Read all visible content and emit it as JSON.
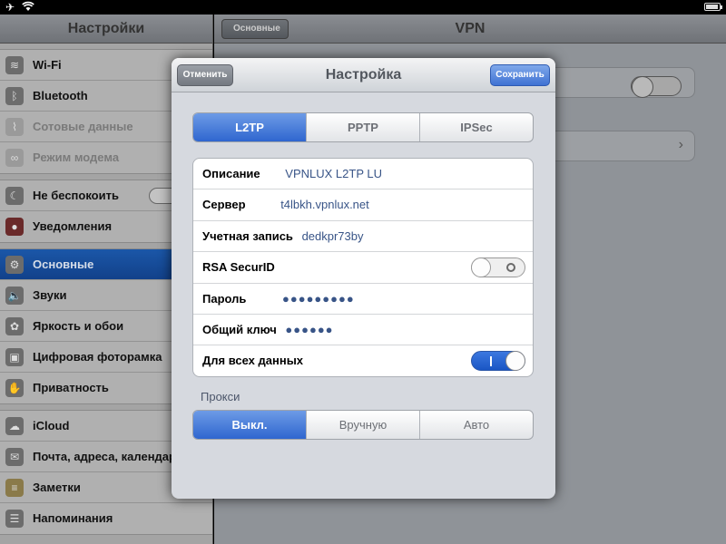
{
  "sidebar": {
    "title": "Настройки",
    "groups": [
      [
        {
          "label": "Wi-Fi",
          "icon": "wifi-icon",
          "state": "normal"
        },
        {
          "label": "Bluetooth",
          "icon": "bluetooth-icon",
          "state": "normal"
        },
        {
          "label": "Сотовые данные",
          "icon": "cellular-icon",
          "state": "disabled"
        },
        {
          "label": "Режим модема",
          "icon": "hotspot-icon",
          "state": "disabled"
        }
      ],
      [
        {
          "label": "Не беспокоить",
          "icon": "moon-icon",
          "state": "normal"
        },
        {
          "label": "Уведомления",
          "icon": "notifications-icon",
          "state": "normal"
        }
      ],
      [
        {
          "label": "Основные",
          "icon": "gear-icon",
          "state": "selected"
        },
        {
          "label": "Звуки",
          "icon": "speaker-icon",
          "state": "normal"
        },
        {
          "label": "Яркость и обои",
          "icon": "flower-icon",
          "state": "normal"
        },
        {
          "label": "Цифровая фоторамка",
          "icon": "picture-frame-icon",
          "state": "normal"
        },
        {
          "label": "Приватность",
          "icon": "hand-icon",
          "state": "normal"
        }
      ],
      [
        {
          "label": "iCloud",
          "icon": "cloud-icon",
          "state": "normal"
        },
        {
          "label": "Почта, адреса, календари",
          "icon": "mail-icon",
          "state": "normal"
        },
        {
          "label": "Заметки",
          "icon": "notes-icon",
          "state": "normal"
        },
        {
          "label": "Напоминания",
          "icon": "reminders-icon",
          "state": "normal"
        }
      ]
    ]
  },
  "detail": {
    "title": "VPN",
    "back_label": "Основные"
  },
  "modal": {
    "title": "Настройка",
    "cancel_label": "Отменить",
    "save_label": "Сохранить",
    "vpn_types": [
      "L2TP",
      "PPTP",
      "IPSec"
    ],
    "vpn_type_selected": 0,
    "fields": {
      "description": {
        "label": "Описание",
        "value": "VPNLUX L2TP LU"
      },
      "server": {
        "label": "Сервер",
        "value": "t4lbkh.vpnlux.net"
      },
      "account": {
        "label": "Учетная запись",
        "value": "dedkpr73by"
      },
      "rsa": {
        "label": "RSA SecurID",
        "on": false
      },
      "password": {
        "label": "Пароль",
        "value": "●●●●●●●●●"
      },
      "secret": {
        "label": "Общий ключ",
        "value": "●●●●●●"
      },
      "send_all": {
        "label": "Для всех данных",
        "on": true
      }
    },
    "proxy": {
      "label": "Прокси",
      "options": [
        "Выкл.",
        "Вручную",
        "Авто"
      ],
      "selected": 0
    }
  }
}
